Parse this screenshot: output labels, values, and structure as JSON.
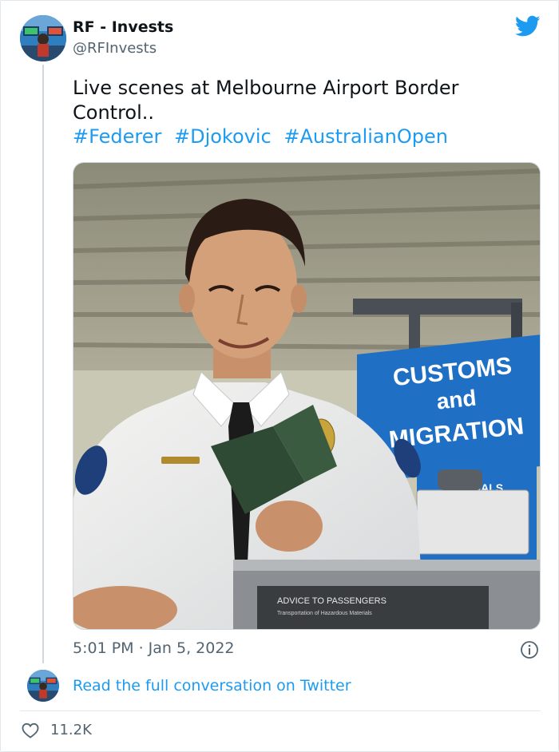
{
  "tweet": {
    "author_name": "RF - Invests",
    "author_handle": "@RFInvests",
    "text": "Live scenes at Melbourne Airport  Border Control..",
    "hashtags": [
      "#Federer",
      "#Djokovic",
      "#AustralianOpen"
    ],
    "timestamp": "5:01 PM · Jan 5, 2022",
    "read_full_label": "Read the full conversation on Twitter",
    "like_count": "11.2K"
  },
  "photo": {
    "sign_line1": "CUSTOMS",
    "sign_line2": "and",
    "sign_line3": "MIGRATION",
    "sign_lower": "NALS",
    "counter_label1": "ADVICE TO PASSENGERS",
    "counter_label2": "Transportation of Hazardous Materials"
  },
  "icons": {
    "brand": "twitter-bird-icon",
    "info": "info-icon",
    "like": "heart-icon"
  },
  "colors": {
    "twitter_blue": "#1d9bf0",
    "text_primary": "#0f1419",
    "text_secondary": "#536471",
    "sign_blue": "#1f6fc4"
  }
}
